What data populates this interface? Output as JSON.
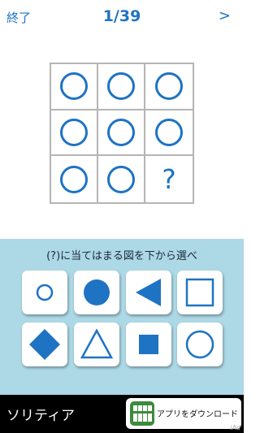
{
  "header": {
    "end_label": "終了",
    "progress": "1/39",
    "next_label": ">"
  },
  "grid": {
    "cells": [
      "circle-outline",
      "circle-outline",
      "circle-outline",
      "circle-outline",
      "circle-outline",
      "circle-outline",
      "circle-outline",
      "circle-outline",
      "?"
    ],
    "question_mark": "?"
  },
  "answer_area": {
    "instruction": "(?)に当てはまる図を下から選べ",
    "choices": [
      "small-circle-outline",
      "filled-circle",
      "filled-left-triangle",
      "square-outline",
      "filled-diamond",
      "triangle-outline",
      "filled-square",
      "circle-outline"
    ]
  },
  "ad": {
    "title": "ソリティア",
    "cta": "アプリをダウンロード",
    "badge": "iAd"
  },
  "colors": {
    "accent": "#1e73c3",
    "answer_bg": "#add8e6",
    "grid_line": "#b5b5b5",
    "ad_bg": "#000000"
  }
}
